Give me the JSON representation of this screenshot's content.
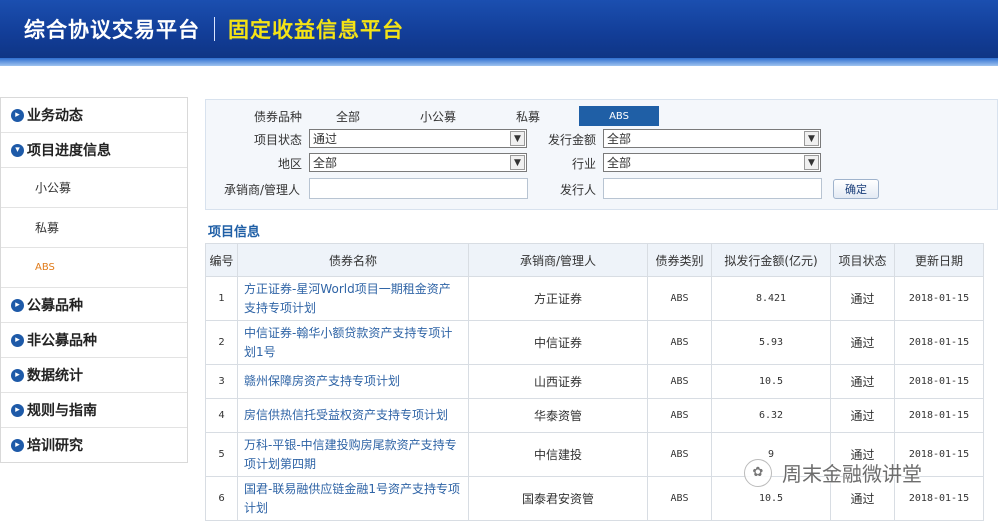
{
  "header": {
    "title_left": "综合协议交易平台",
    "title_right": "固定收益信息平台"
  },
  "sidebar": {
    "items": [
      {
        "label": "业务动态",
        "icon": "chevron-right-icon"
      },
      {
        "label": "项目进度信息",
        "icon": "chevron-down-icon"
      }
    ],
    "subitems": [
      {
        "label": "小公募"
      },
      {
        "label": "私募"
      },
      {
        "label": "ABS",
        "active": true
      }
    ],
    "items2": [
      {
        "label": "公募品种",
        "icon": "chevron-right-icon"
      },
      {
        "label": "非公募品种",
        "icon": "chevron-right-icon"
      },
      {
        "label": "数据统计",
        "icon": "chevron-right-icon"
      },
      {
        "label": "规则与指南",
        "icon": "chevron-right-icon"
      },
      {
        "label": "培训研究",
        "icon": "chevron-right-icon"
      }
    ]
  },
  "filter": {
    "bond_type_label": "债券品种",
    "types": [
      "全部",
      "小公募",
      "私募",
      "ABS"
    ],
    "selected_type": "ABS",
    "status_label": "项目状态",
    "status_value": "通过",
    "amount_label": "发行金额",
    "amount_value": "全部",
    "region_label": "地区",
    "region_value": "全部",
    "industry_label": "行业",
    "industry_value": "全部",
    "underwriter_label": "承销商/管理人",
    "underwriter_value": "",
    "issuer_label": "发行人",
    "issuer_value": "",
    "confirm_label": "确定"
  },
  "section_title": "项目信息",
  "table": {
    "headers": [
      "编号",
      "债券名称",
      "承销商/管理人",
      "债券类别",
      "拟发行金额(亿元)",
      "项目状态",
      "更新日期"
    ],
    "rows": [
      {
        "no": "1",
        "name": "方正证券-星河World项目一期租金资产支持专项计划",
        "underwriter": "方正证券",
        "type": "ABS",
        "amount": "8.421",
        "status": "通过",
        "date": "2018-01-15"
      },
      {
        "no": "2",
        "name": "中信证券-翰华小额贷款资产支持专项计划1号",
        "underwriter": "中信证券",
        "type": "ABS",
        "amount": "5.93",
        "status": "通过",
        "date": "2018-01-15"
      },
      {
        "no": "3",
        "name": "赣州保障房资产支持专项计划",
        "underwriter": "山西证券",
        "type": "ABS",
        "amount": "10.5",
        "status": "通过",
        "date": "2018-01-15"
      },
      {
        "no": "4",
        "name": "房信供热信托受益权资产支持专项计划",
        "underwriter": "华泰资管",
        "type": "ABS",
        "amount": "6.32",
        "status": "通过",
        "date": "2018-01-15"
      },
      {
        "no": "5",
        "name": "万科-平银-中信建投购房尾款资产支持专项计划第四期",
        "underwriter": "中信建投",
        "type": "ABS",
        "amount": "9",
        "status": "通过",
        "date": "2018-01-15"
      },
      {
        "no": "6",
        "name": "国君-联易融供应链金融1号资产支持专项计划",
        "underwriter": "国泰君安资管",
        "type": "ABS",
        "amount": "10.5",
        "status": "通过",
        "date": "2018-01-15"
      }
    ]
  },
  "watermark": {
    "text": "周末金融微讲堂"
  }
}
